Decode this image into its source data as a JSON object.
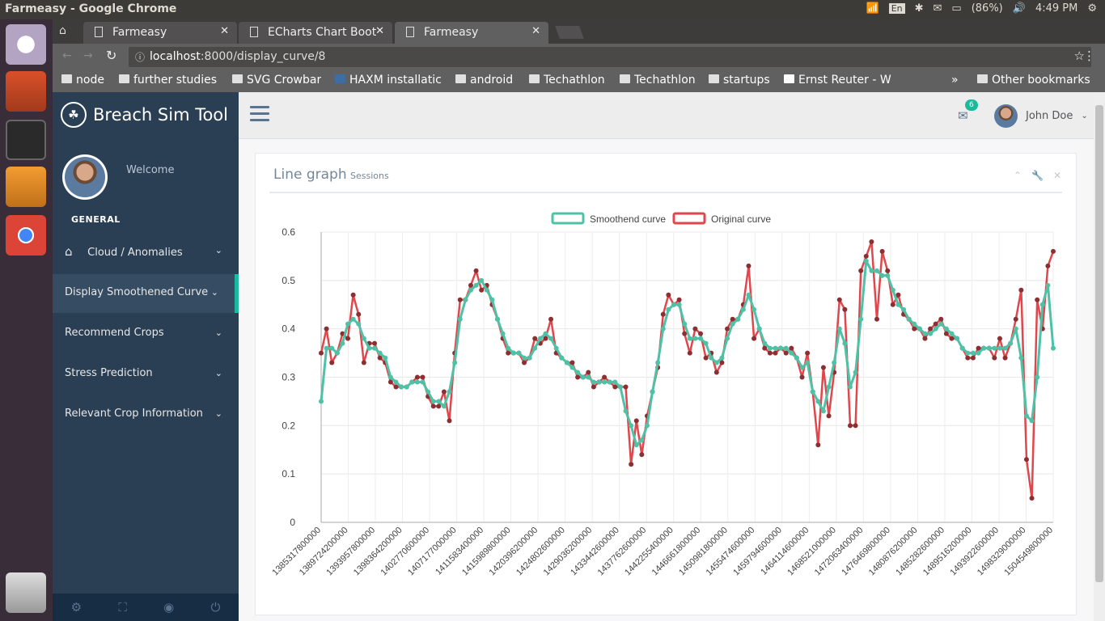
{
  "os": {
    "window_title": "Farmeasy - Google Chrome",
    "keyboard": "En",
    "battery": "(86%)",
    "clock": "4:49 PM"
  },
  "browser": {
    "tabs": [
      {
        "title": "Farmeasy"
      },
      {
        "title": "ECharts Chart Boot"
      },
      {
        "title": "Farmeasy"
      }
    ],
    "url_host": "localhost",
    "url_path": ":8000/display_curve/8",
    "bookmarks": [
      "node",
      "further studies",
      "SVG Crowbar",
      "HAXM installatic",
      "android",
      "Techathlon",
      "Techathlon",
      "startups",
      "Ernst Reuter - W"
    ],
    "other_bookmarks": "Other bookmarks"
  },
  "sidebar": {
    "brand": "Breach Sim Tool",
    "welcome": "Welcome",
    "section": "GENERAL",
    "items": [
      {
        "label": "Cloud / Anomalies"
      },
      {
        "label": "Display Smoothened Curve"
      },
      {
        "label": "Recommend Crops"
      },
      {
        "label": "Stress Prediction"
      },
      {
        "label": "Relevant Crop Information"
      }
    ]
  },
  "topnav": {
    "mail_count": "6",
    "user_name": "John Doe"
  },
  "panel": {
    "title": "Line graph",
    "subtitle": "Sessions"
  },
  "chart_data": {
    "type": "line",
    "legend": [
      "Smoothend curve",
      "Original curve"
    ],
    "colors": {
      "smoothend": "#4fc1a6",
      "original": "#e0474c",
      "original_points": "#8c2f33"
    },
    "ylim": [
      0,
      0.6
    ],
    "yticks": [
      0,
      0.1,
      0.2,
      0.3,
      0.4,
      0.5,
      0.6
    ],
    "xtick_labels": [
      "1385317800000",
      "1389724200000",
      "1393957800000",
      "1398364200000",
      "1402770600000",
      "1407177000000",
      "1411583400000",
      "1415989800000",
      "1420396200000",
      "1424802600000",
      "1429036200000",
      "1433442600000",
      "1437762600000",
      "1442255400000",
      "1446661800000",
      "1450981800000",
      "1455474600000",
      "1459794600000",
      "1464114600000",
      "1468521000000",
      "1472063400000",
      "1476469800000",
      "1480876200000",
      "1485282600000",
      "1489516200000",
      "1493922600000",
      "1498329000000",
      "1504549800000"
    ],
    "series": [
      {
        "name": "Original curve",
        "values": [
          0.35,
          0.4,
          0.33,
          0.35,
          0.39,
          0.38,
          0.47,
          0.43,
          0.33,
          0.37,
          0.37,
          0.34,
          0.33,
          0.29,
          0.28,
          0.28,
          0.28,
          0.29,
          0.3,
          0.3,
          0.26,
          0.24,
          0.24,
          0.27,
          0.21,
          0.35,
          0.46,
          0.46,
          0.49,
          0.52,
          0.48,
          0.49,
          0.45,
          0.42,
          0.38,
          0.35,
          0.35,
          0.35,
          0.33,
          0.34,
          0.38,
          0.37,
          0.38,
          0.42,
          0.35,
          0.34,
          0.33,
          0.33,
          0.3,
          0.3,
          0.31,
          0.28,
          0.29,
          0.3,
          0.29,
          0.28,
          0.28,
          0.28,
          0.12,
          0.21,
          0.14,
          0.22,
          0.27,
          0.32,
          0.43,
          0.47,
          0.45,
          0.46,
          0.39,
          0.35,
          0.4,
          0.39,
          0.34,
          0.35,
          0.31,
          0.33,
          0.4,
          0.42,
          0.42,
          0.45,
          0.53,
          0.38,
          0.4,
          0.36,
          0.35,
          0.35,
          0.36,
          0.35,
          0.36,
          0.34,
          0.3,
          0.35,
          0.27,
          0.16,
          0.32,
          0.22,
          0.31,
          0.46,
          0.44,
          0.2,
          0.2,
          0.52,
          0.55,
          0.58,
          0.42,
          0.56,
          0.52,
          0.45,
          0.47,
          0.43,
          0.42,
          0.4,
          0.4,
          0.38,
          0.4,
          0.41,
          0.42,
          0.39,
          0.38,
          0.38,
          0.36,
          0.34,
          0.34,
          0.36,
          0.36,
          0.36,
          0.34,
          0.38,
          0.34,
          0.37,
          0.42,
          0.48,
          0.13,
          0.05,
          0.46,
          0.4,
          0.53,
          0.56
        ]
      },
      {
        "name": "Smoothend curve",
        "values": [
          0.25,
          0.36,
          0.36,
          0.35,
          0.37,
          0.41,
          0.42,
          0.41,
          0.38,
          0.36,
          0.36,
          0.35,
          0.34,
          0.3,
          0.29,
          0.28,
          0.28,
          0.29,
          0.29,
          0.29,
          0.27,
          0.25,
          0.25,
          0.24,
          0.27,
          0.33,
          0.42,
          0.46,
          0.48,
          0.49,
          0.5,
          0.48,
          0.46,
          0.42,
          0.39,
          0.36,
          0.35,
          0.35,
          0.34,
          0.34,
          0.36,
          0.38,
          0.39,
          0.38,
          0.36,
          0.34,
          0.33,
          0.32,
          0.31,
          0.3,
          0.3,
          0.29,
          0.29,
          0.29,
          0.29,
          0.29,
          0.28,
          0.23,
          0.2,
          0.16,
          0.17,
          0.2,
          0.27,
          0.33,
          0.4,
          0.44,
          0.45,
          0.45,
          0.41,
          0.38,
          0.38,
          0.38,
          0.37,
          0.34,
          0.33,
          0.34,
          0.38,
          0.41,
          0.42,
          0.44,
          0.47,
          0.44,
          0.4,
          0.37,
          0.36,
          0.36,
          0.36,
          0.36,
          0.35,
          0.34,
          0.32,
          0.33,
          0.27,
          0.25,
          0.23,
          0.28,
          0.33,
          0.4,
          0.37,
          0.28,
          0.31,
          0.42,
          0.54,
          0.52,
          0.52,
          0.51,
          0.51,
          0.48,
          0.45,
          0.44,
          0.42,
          0.41,
          0.4,
          0.39,
          0.39,
          0.4,
          0.41,
          0.4,
          0.39,
          0.38,
          0.36,
          0.35,
          0.35,
          0.35,
          0.36,
          0.36,
          0.36,
          0.36,
          0.36,
          0.37,
          0.4,
          0.34,
          0.22,
          0.21,
          0.3,
          0.45,
          0.49,
          0.36
        ]
      }
    ]
  }
}
